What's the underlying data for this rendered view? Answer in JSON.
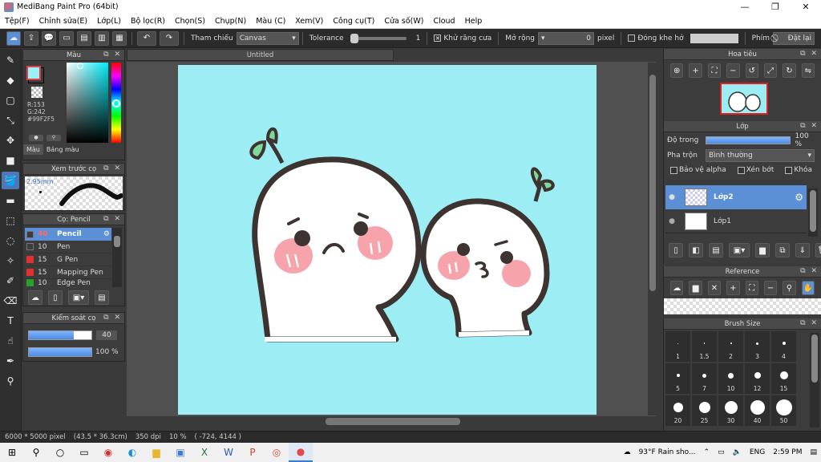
{
  "window": {
    "title": "MediBang Paint Pro (64bit)",
    "minimize": "—",
    "maximize": "❐",
    "close": "✕"
  },
  "menu": [
    "Tệp(F)",
    "Chỉnh sửa(E)",
    "Lớp(L)",
    "Bộ lọc(R)",
    "Chọn(S)",
    "Chụp(N)",
    "Màu (C)",
    "Xem(V)",
    "Công cụ(T)",
    "Cửa số(W)",
    "Cloud",
    "Help"
  ],
  "toolbar": {
    "reference_label": "Tham chiếu",
    "reference_value": "Canvas",
    "tolerance_label": "Tolerance",
    "tolerance_value": "1",
    "antialias_label": "Khử răng cưa",
    "expand_label": "Mở rộng",
    "expand_value": "0",
    "expand_unit": "pixel",
    "close_gap_label": "Đóng khe hở",
    "key_label": "Phím",
    "reset_label": "Đặt lại"
  },
  "color_panel": {
    "title": "Màu",
    "r": "R:153",
    "g": "G:242",
    "hex": "#99F2F5",
    "tab_color": "Màu",
    "tab_palette": "Bảng màu",
    "current_color": "#99f2f5",
    "secondary_color": "#ff6f6f"
  },
  "brush_preview": {
    "title": "Xem trước cọ",
    "size": "2.95mm"
  },
  "brush_panel": {
    "title": "Cọ: Pencil",
    "items": [
      {
        "size": "40",
        "name": "Pencil",
        "color": "#3c3c3c",
        "active": true
      },
      {
        "size": "10",
        "name": "Pen",
        "color": "#3c3c3c",
        "active": false
      },
      {
        "size": "15",
        "name": "G Pen",
        "color": "#e03030",
        "active": false
      },
      {
        "size": "15",
        "name": "Mapping Pen",
        "color": "#e03030",
        "active": false
      },
      {
        "size": "10",
        "name": "Edge Pen",
        "color": "#2aa02a",
        "active": false
      }
    ]
  },
  "brush_control": {
    "title": "Kiểm soát cọ",
    "size_value": "40",
    "size_fill": 0.72,
    "opacity_value": "100 %"
  },
  "document": {
    "tab": "Untitled"
  },
  "status": {
    "size": "6000 * 5000 pixel",
    "size_cm": "(43.5 * 36.3cm)",
    "dpi": "350 dpi",
    "zoom": "10 %",
    "coords": "( -724, 4144 )"
  },
  "navigator": {
    "title": "Hoa tiêu"
  },
  "layer_panel": {
    "title": "Lớp",
    "opacity_label": "Độ trong",
    "opacity_value": "100 %",
    "blend_label": "Pha trộn",
    "blend_value": "Bình thường",
    "protect_alpha": "Bảo vệ alpha",
    "clipping": "Xén bớt",
    "lock": "Khóa",
    "layers": [
      {
        "name": "Lớp2",
        "active": true
      },
      {
        "name": "Lớp1",
        "active": false
      }
    ]
  },
  "reference_panel": {
    "title": "Reference"
  },
  "brush_size_panel": {
    "title": "Brush Size",
    "sizes": [
      "1",
      "1.5",
      "2",
      "3",
      "4",
      "5",
      "7",
      "10",
      "12",
      "15",
      "20",
      "25",
      "30",
      "40",
      "50"
    ]
  },
  "taskbar": {
    "weather": "93°F  Rain sho...",
    "lang": "ENG",
    "time": "2:59 PM"
  }
}
